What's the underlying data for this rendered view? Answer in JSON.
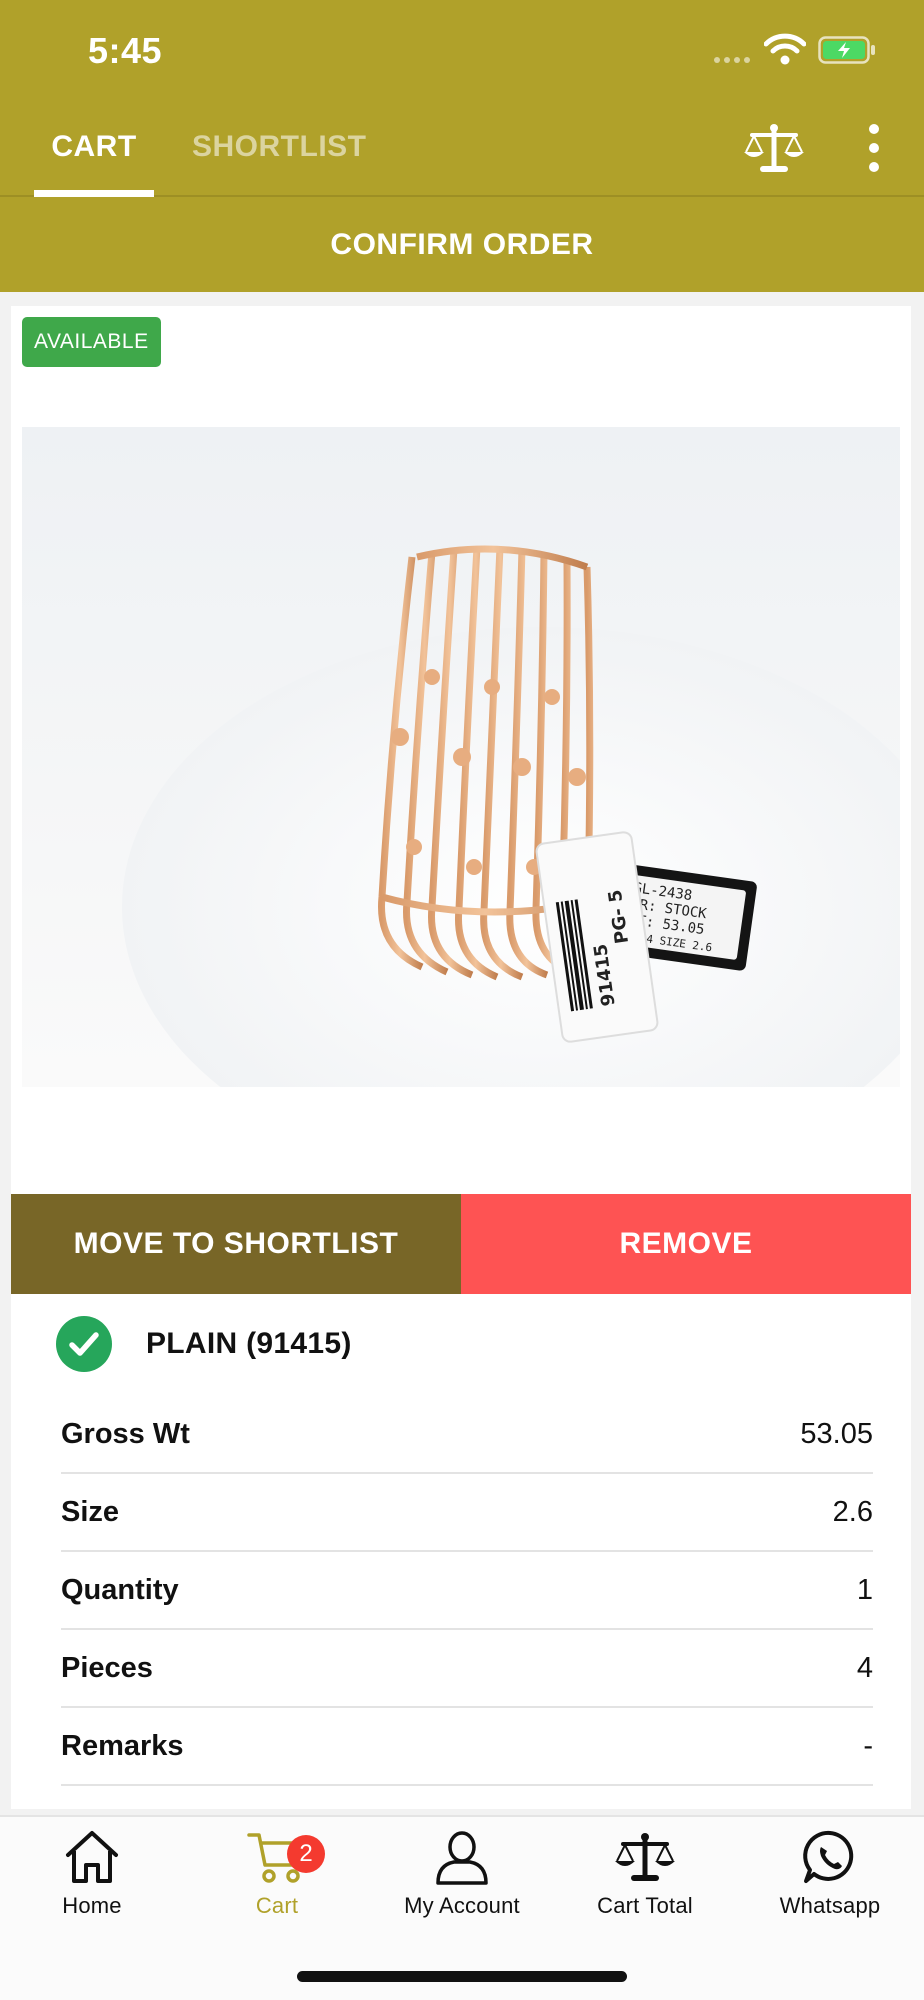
{
  "status_bar": {
    "time": "5:45"
  },
  "tabs": [
    {
      "label": "CART",
      "active": true
    },
    {
      "label": "SHORTLIST",
      "active": false
    }
  ],
  "header_icons": [
    "scale-icon",
    "more-vertical-icon"
  ],
  "confirm_order_label": "CONFIRM ORDER",
  "product": {
    "availability": "AVAILABLE",
    "image_tag_text": [
      "91415",
      "PG- 5",
      "GL-2438",
      "OR: STOCK",
      "WT: 53.05",
      "CE 4 SIZE 2.6"
    ],
    "move_to_shortlist_label": "MOVE TO SHORTLIST",
    "remove_label": "REMOVE",
    "name": "PLAIN (91415)",
    "specs": [
      {
        "label": "Gross Wt",
        "value": "53.05"
      },
      {
        "label": "Size",
        "value": "2.6"
      },
      {
        "label": "Quantity",
        "value": "1"
      },
      {
        "label": "Pieces",
        "value": "4"
      },
      {
        "label": "Remarks",
        "value": "-"
      }
    ]
  },
  "bottom_nav": {
    "items": [
      {
        "label": "Home",
        "icon": "home-icon",
        "active": false
      },
      {
        "label": "Cart",
        "icon": "cart-icon",
        "active": true,
        "badge": "2"
      },
      {
        "label": "My Account",
        "icon": "user-icon",
        "active": false
      },
      {
        "label": "Cart Total",
        "icon": "scale-icon",
        "active": false
      },
      {
        "label": "Whatsapp",
        "icon": "whatsapp-icon",
        "active": false
      }
    ]
  },
  "colors": {
    "header": "#b0a12a",
    "available_badge": "#3fa84a",
    "move_to_shortlist": "#786627",
    "remove": "#fe5353",
    "cart_badge": "#f43a2f"
  }
}
